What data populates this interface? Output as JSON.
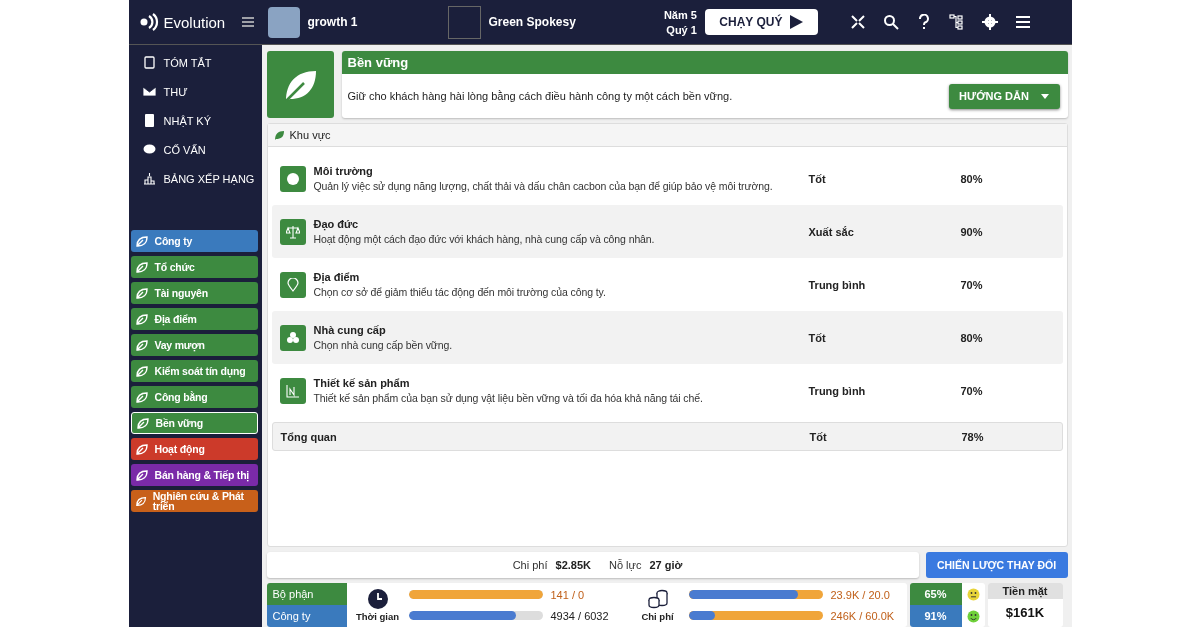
{
  "topbar": {
    "brand": "Evolution",
    "game": "growth 1",
    "company": "Green Spokesy",
    "year": "Năm 5",
    "quarter": "Quý 1",
    "run_button": "CHẠY QUÝ"
  },
  "menu": [
    {
      "label": "TÓM TẮT"
    },
    {
      "label": "THƯ"
    },
    {
      "label": "NHẬT KÝ"
    },
    {
      "label": "CỐ VẤN"
    },
    {
      "label": "BẢNG XẾP HẠNG"
    }
  ],
  "departments": [
    {
      "label": "Công ty",
      "color": "#3a7abd",
      "selected": false
    },
    {
      "label": "Tổ chức",
      "color": "#3d8a40",
      "selected": false
    },
    {
      "label": "Tài nguyên",
      "color": "#3d8a40",
      "selected": false
    },
    {
      "label": "Địa điểm",
      "color": "#3d8a40",
      "selected": false
    },
    {
      "label": "Vay mượn",
      "color": "#3d8a40",
      "selected": false
    },
    {
      "label": "Kiểm soát tín dụng",
      "color": "#3d8a40",
      "selected": false
    },
    {
      "label": "Công bằng",
      "color": "#3d8a40",
      "selected": false
    },
    {
      "label": "Bền vững",
      "color": "#3d8a40",
      "selected": true
    },
    {
      "label": "Hoạt động",
      "color": "#cc3a2a",
      "selected": false
    },
    {
      "label": "Bán hàng & Tiếp thị",
      "color": "#7a2aa8",
      "selected": false
    },
    {
      "label": "Nghiên cứu & Phát triển",
      "color": "#c8601a",
      "selected": false
    }
  ],
  "header": {
    "title": "Bền vững",
    "description": "Giữ cho khách hàng hài lòng bằng cách điều hành công ty một cách bền vững.",
    "guide_button": "HƯỚNG DẪN"
  },
  "areas": {
    "title": "Khu vực",
    "rows": [
      {
        "name": "Môi trường",
        "description": "Quản lý việc sử dụng năng lượng, chất thải và dấu chân cacbon của bạn để giúp bảo vệ môi trường.",
        "rating": "Tốt",
        "score": "80%"
      },
      {
        "name": "Đạo đức",
        "description": "Hoạt động một cách đạo đức với khách hàng, nhà cung cấp và công nhân.",
        "rating": "Xuất sắc",
        "score": "90%"
      },
      {
        "name": "Địa điểm",
        "description": "Chọn cơ sở để giảm thiểu tác động đến môi trường của công ty.",
        "rating": "Trung bình",
        "score": "70%"
      },
      {
        "name": "Nhà cung cấp",
        "description": "Chọn nhà cung cấp bền vững.",
        "rating": "Tốt",
        "score": "80%"
      },
      {
        "name": "Thiết kế sản phẩm",
        "description": "Thiết kế sản phẩm của bạn sử dụng vật liệu bền vững và tối đa hóa khả năng tái chế.",
        "rating": "Trung bình",
        "score": "70%"
      }
    ],
    "overview": {
      "label": "Tổng quan",
      "rating": "Tốt",
      "score": "78%"
    }
  },
  "cost_bar": {
    "cost_label": "Chi phí",
    "cost": "$2.85K",
    "effort_label": "Nỗ lực",
    "effort": "27 giờ",
    "change_button": "CHIẾN LƯỢC THAY ĐỔI"
  },
  "stats": {
    "rows": [
      "Bộ phận",
      "Công ty"
    ],
    "time": {
      "label": "Thời gian",
      "bars": [
        {
          "kind": "overrun",
          "level": 1,
          "reading": "141 / 0"
        },
        {
          "kind": "normal",
          "level": 0.8,
          "reading": "4934 / 6032"
        }
      ]
    },
    "cost": {
      "label": "Chi phí",
      "bars": [
        {
          "kind": "over",
          "level": 0.82,
          "reading": "23.9K / 20.0"
        },
        {
          "kind": "over",
          "level": 0.2,
          "reading": "246K / 60.0K"
        }
      ]
    },
    "satisfaction": [
      {
        "value": "65%",
        "kind": "neutral"
      },
      {
        "value": "91%",
        "kind": "happy"
      }
    ],
    "cash_label": "Tiền mặt",
    "cash": "$161K"
  }
}
